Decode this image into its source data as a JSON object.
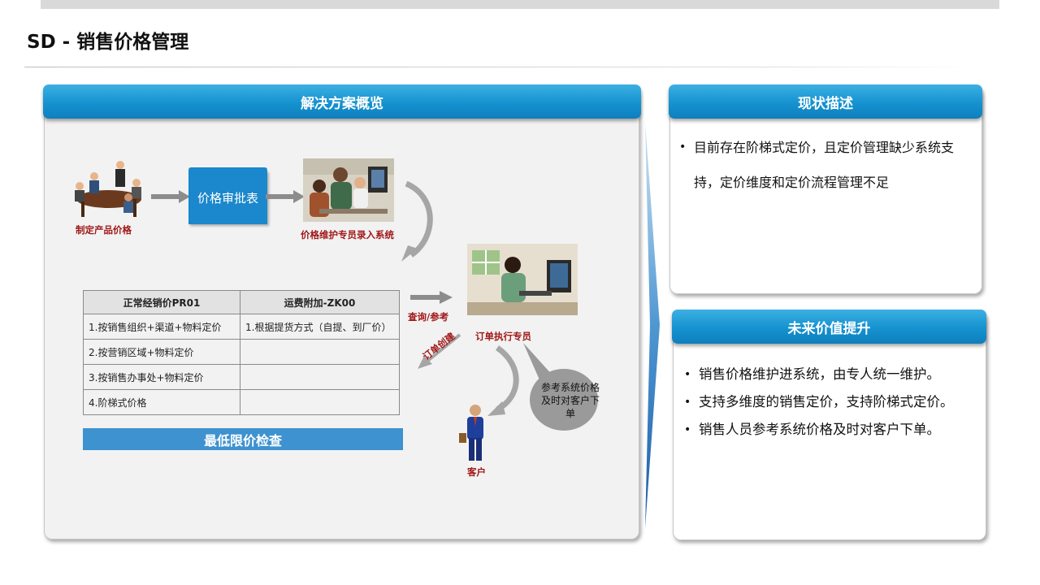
{
  "page_title": "SD - 销售价格管理",
  "left_panel": {
    "header": "解决方案概览",
    "labels": {
      "make_price": "制定产品价格",
      "approval_form": "价格审批表",
      "maintainer": "价格维护专员录入系统",
      "query": "查询/参考",
      "executor": "订单执行专员",
      "order_create": "订单创建",
      "customer": "客户",
      "bubble": "参考系统价格及时对客户下单"
    },
    "table": {
      "headers": [
        "正常经销价PR01",
        "运费附加-ZK00"
      ],
      "rows": [
        [
          "1.按销售组织+渠道+物料定价",
          "1.根据提货方式（自提、到厂价）"
        ],
        [
          "2.按营销区域+物料定价",
          ""
        ],
        [
          "3.按销售办事处+物料定价",
          ""
        ],
        [
          "4.阶梯式价格",
          ""
        ]
      ]
    },
    "min_check": "最低限价检查"
  },
  "status_panel": {
    "header": "现状描述",
    "items": [
      "目前存在阶梯式定价，且定价管理缺少系统支持，定价维度和定价流程管理不足"
    ]
  },
  "future_panel": {
    "header": "未来价值提升",
    "items": [
      "销售价格维护进系统，由专人统一维护。",
      "支持多维度的销售定价，支持阶梯式定价。",
      "销售人员参考系统价格及时对客户下单。"
    ]
  },
  "colors": {
    "header_blue": "#1592cf",
    "label_red": "#a01818",
    "min_bar": "#3d92cf"
  }
}
